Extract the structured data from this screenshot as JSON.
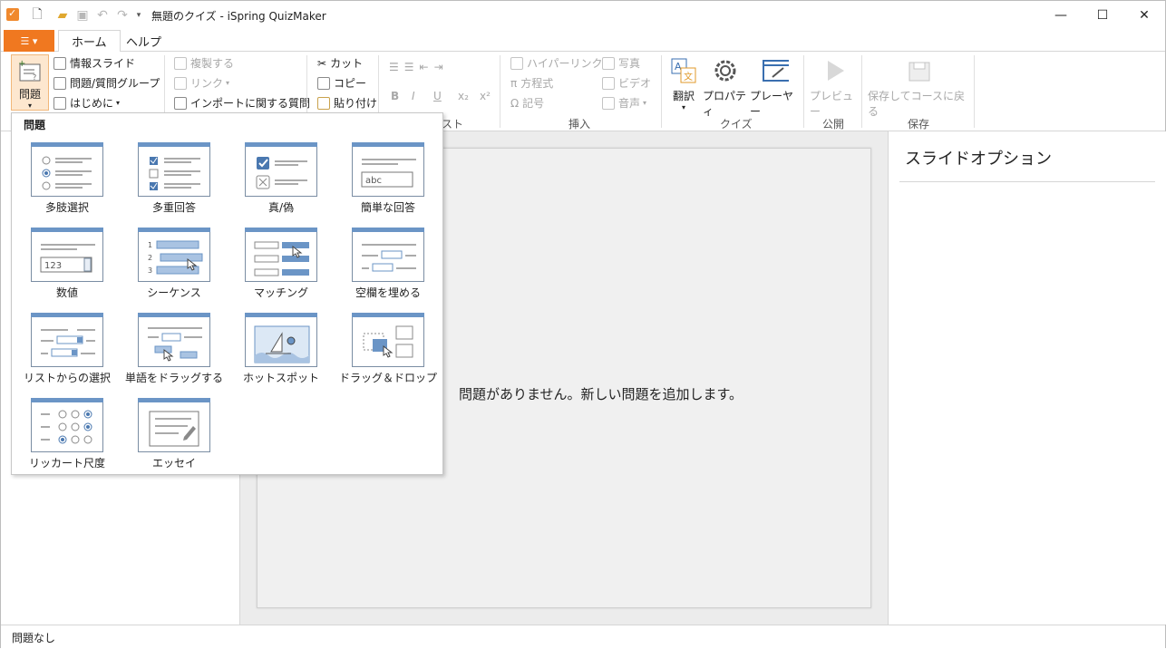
{
  "window": {
    "title": "無題のクイズ - iSpring QuizMaker",
    "minimize": "—",
    "maximize": "☐",
    "close": "✕"
  },
  "tabs": {
    "file_icon": "☰ ▾",
    "home": "ホーム",
    "help": "ヘルプ"
  },
  "ribbon": {
    "question_big": "問題",
    "info_slide": "情報スライド",
    "question_group": "問題/質問グループ",
    "intro": "はじめに",
    "duplicate": "複製する",
    "link": "リンク",
    "import_questions": "インポートに関する質問",
    "cut": "カット",
    "copy": "コピー",
    "paste": "貼り付け",
    "text_group_partial": "スト",
    "hyperlink": "ハイパーリンク",
    "equation": "方程式",
    "symbol": "記号",
    "photo": "写真",
    "video": "ビデオ",
    "audio": "音声",
    "insert_label": "挿入",
    "translate": "翻訳",
    "properties": "プロパティ",
    "player": "プレーヤー",
    "quiz_label": "クイズ",
    "preview": "プレビュー",
    "publish_label": "公開",
    "save_return": "保存してコースに戻る",
    "save_label": "保存",
    "bold": "B",
    "italic": "I",
    "underline": "U",
    "subscript": "x₂",
    "superscript": "x²"
  },
  "dropdown": {
    "header": "問題",
    "items": [
      {
        "label": "多肢選択",
        "icon": "multiple-choice-icon"
      },
      {
        "label": "多重回答",
        "icon": "multiple-response-icon"
      },
      {
        "label": "真/偽",
        "icon": "true-false-icon"
      },
      {
        "label": "簡単な回答",
        "icon": "short-answer-icon"
      },
      {
        "label": "数値",
        "icon": "numeric-icon"
      },
      {
        "label": "シーケンス",
        "icon": "sequence-icon"
      },
      {
        "label": "マッチング",
        "icon": "matching-icon"
      },
      {
        "label": "空欄を埋める",
        "icon": "fill-in-blank-icon"
      },
      {
        "label": "リストからの選択",
        "icon": "select-from-list-icon"
      },
      {
        "label": "単語をドラッグする",
        "icon": "drag-words-icon"
      },
      {
        "label": "ホットスポット",
        "icon": "hotspot-icon"
      },
      {
        "label": "ドラッグ＆ドロップ",
        "icon": "drag-and-drop-icon"
      },
      {
        "label": "リッカート尺度",
        "icon": "likert-scale-icon"
      },
      {
        "label": "エッセイ",
        "icon": "essay-icon"
      }
    ],
    "short_answer_sample": "abc",
    "numeric_sample": "123"
  },
  "main": {
    "empty_message": "問題がありません。新しい問題を追加します。"
  },
  "right_panel": {
    "title": "スライドオプション"
  },
  "status": {
    "text": "問題なし"
  },
  "colors": {
    "accent": "#f07820",
    "thumb_header": "#6b95c6"
  }
}
